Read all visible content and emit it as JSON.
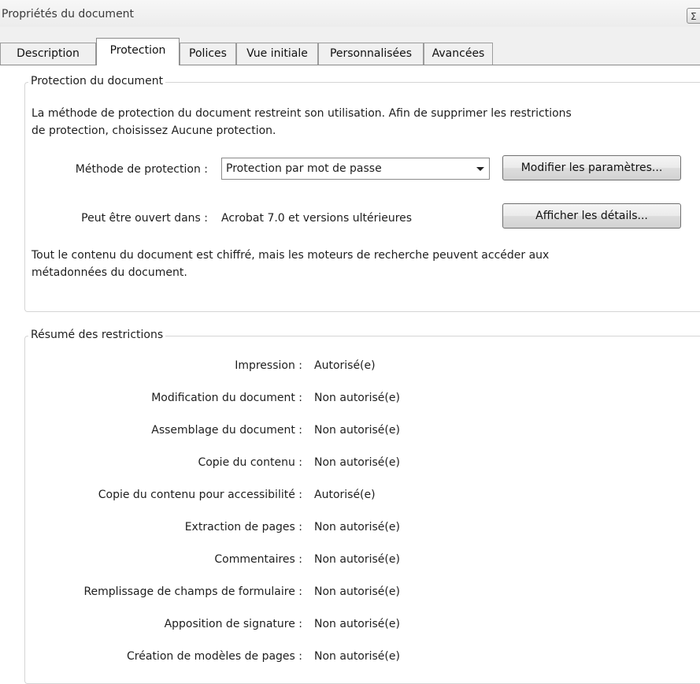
{
  "window": {
    "title": "Propriétés du document",
    "close_glyph": "Σ"
  },
  "tabs": [
    {
      "label": "Description"
    },
    {
      "label": "Protection",
      "active": true
    },
    {
      "label": "Polices"
    },
    {
      "label": "Vue initiale"
    },
    {
      "label": "Personnalisées"
    },
    {
      "label": "Avancées"
    }
  ],
  "protection": {
    "legend": "Protection du document",
    "intro_line1": "La méthode de protection du document restreint son utilisation. Afin de supprimer les restrictions",
    "intro_line2": "de protection, choisissez Aucune protection.",
    "method_label": "Méthode de protection :",
    "method_value": "Protection par mot de passe",
    "modify_button": "Modifier les paramètres...",
    "open_label": "Peut être ouvert dans :",
    "open_value": "Acrobat 7.0 et versions ultérieures",
    "details_button": "Afficher les détails...",
    "note_line1": "Tout le contenu du document est chiffré, mais les moteurs de recherche peuvent accéder aux",
    "note_line2": "métadonnées du document."
  },
  "restrictions": {
    "legend": "Résumé des restrictions",
    "rows": [
      {
        "label": "Impression :",
        "value": "Autorisé(e)"
      },
      {
        "label": "Modification du document :",
        "value": "Non autorisé(e)"
      },
      {
        "label": "Assemblage du document :",
        "value": "Non autorisé(e)"
      },
      {
        "label": "Copie du contenu :",
        "value": "Non autorisé(e)"
      },
      {
        "label": "Copie du contenu pour accessibilité :",
        "value": "Autorisé(e)"
      },
      {
        "label": "Extraction de pages :",
        "value": "Non autorisé(e)"
      },
      {
        "label": "Commentaires :",
        "value": "Non autorisé(e)"
      },
      {
        "label": "Remplissage de champs de formulaire :",
        "value": "Non autorisé(e)"
      },
      {
        "label": "Apposition de signature :",
        "value": "Non autorisé(e)"
      },
      {
        "label": "Création de modèles de pages :",
        "value": "Non autorisé(e)"
      }
    ]
  }
}
